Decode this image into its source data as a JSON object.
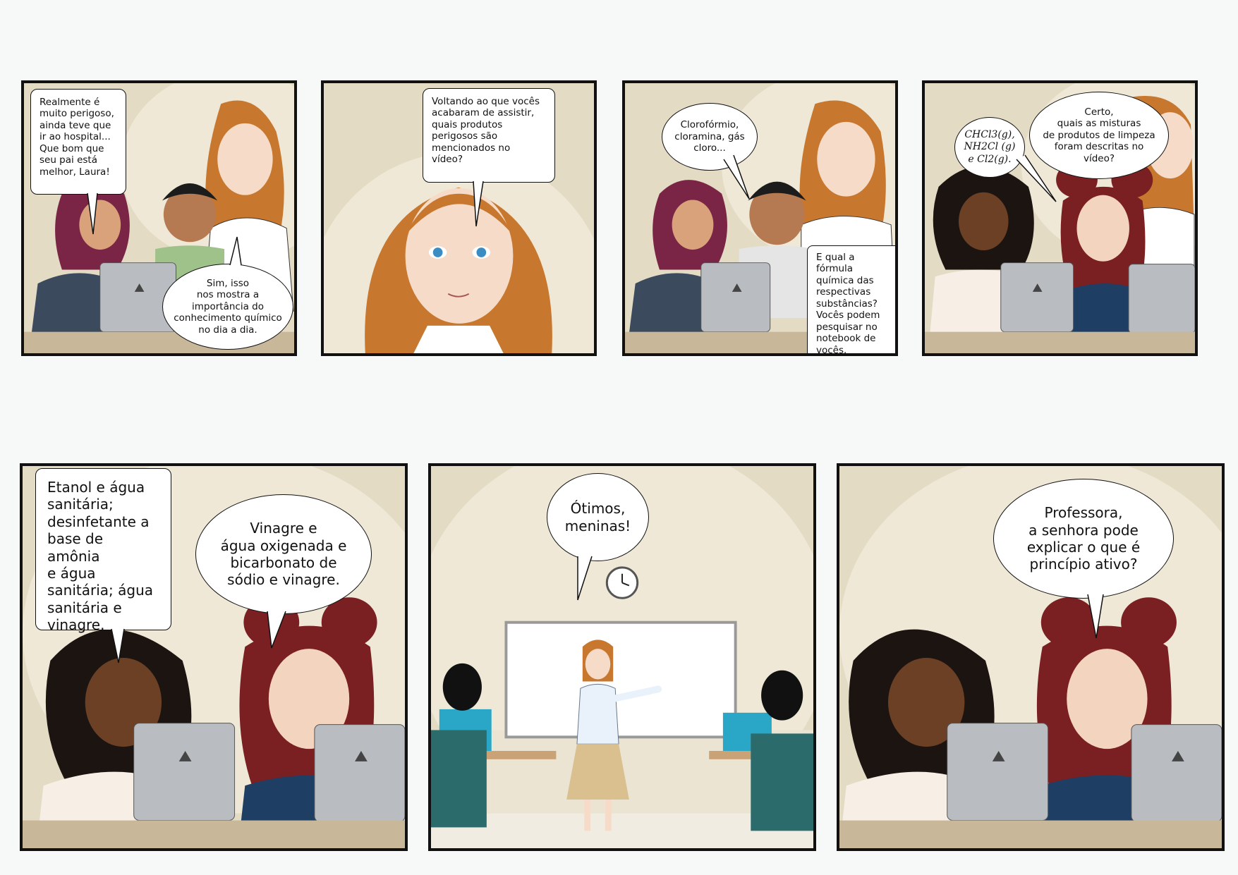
{
  "panels": [
    {
      "bubbles": [
        "Realmente é\nmuito perigoso,\nainda teve que\nir ao hospital...\nQue bom que\nseu pai está\nmelhor, Laura!",
        "Sim, isso\nnos mostra a\nimportância do\nconhecimento químico\nno dia a dia."
      ]
    },
    {
      "bubbles": [
        "Voltando ao que vocês\nacabaram de assistir,\nquais produtos\nperigosos são\nmencionados no\nvídeo?"
      ]
    },
    {
      "bubbles": [
        "Clorofórmio,\ncloramina, gás\ncloro...",
        "E qual a fórmula\nquímica das\nrespectivas\nsubstâncias?\nVocês podem\npesquisar no\nnotebook de\nvocês."
      ]
    },
    {
      "bubbles": [
        "CHCl3(g),\nNH2Cl (g)\ne Cl2(g).",
        "Certo,\nquais as misturas\nde produtos de limpeza\nforam descritas no\nvídeo?"
      ]
    },
    {
      "bubbles": [
        "Etanol e água\nsanitária;\ndesinfetante a\nbase de amônia\ne água\nsanitária; água\nsanitária e\nvinagre.",
        "Vinagre e\nágua oxigenada e\nbicarbonato de\nsódio e vinagre."
      ]
    },
    {
      "bubbles": [
        "Ótimos,\nmeninas!"
      ]
    },
    {
      "bubbles": [
        "Professora,\na senhora pode\nexplicar o que é\nprincípio ativo?"
      ]
    }
  ],
  "colors": {
    "wall": "#e4dbc4",
    "border": "#111111",
    "laptop": "#b9bcc0",
    "hijab": "#7a2546",
    "teacher_hair": "#c8772e",
    "redhead_hair": "#7a1f22"
  }
}
